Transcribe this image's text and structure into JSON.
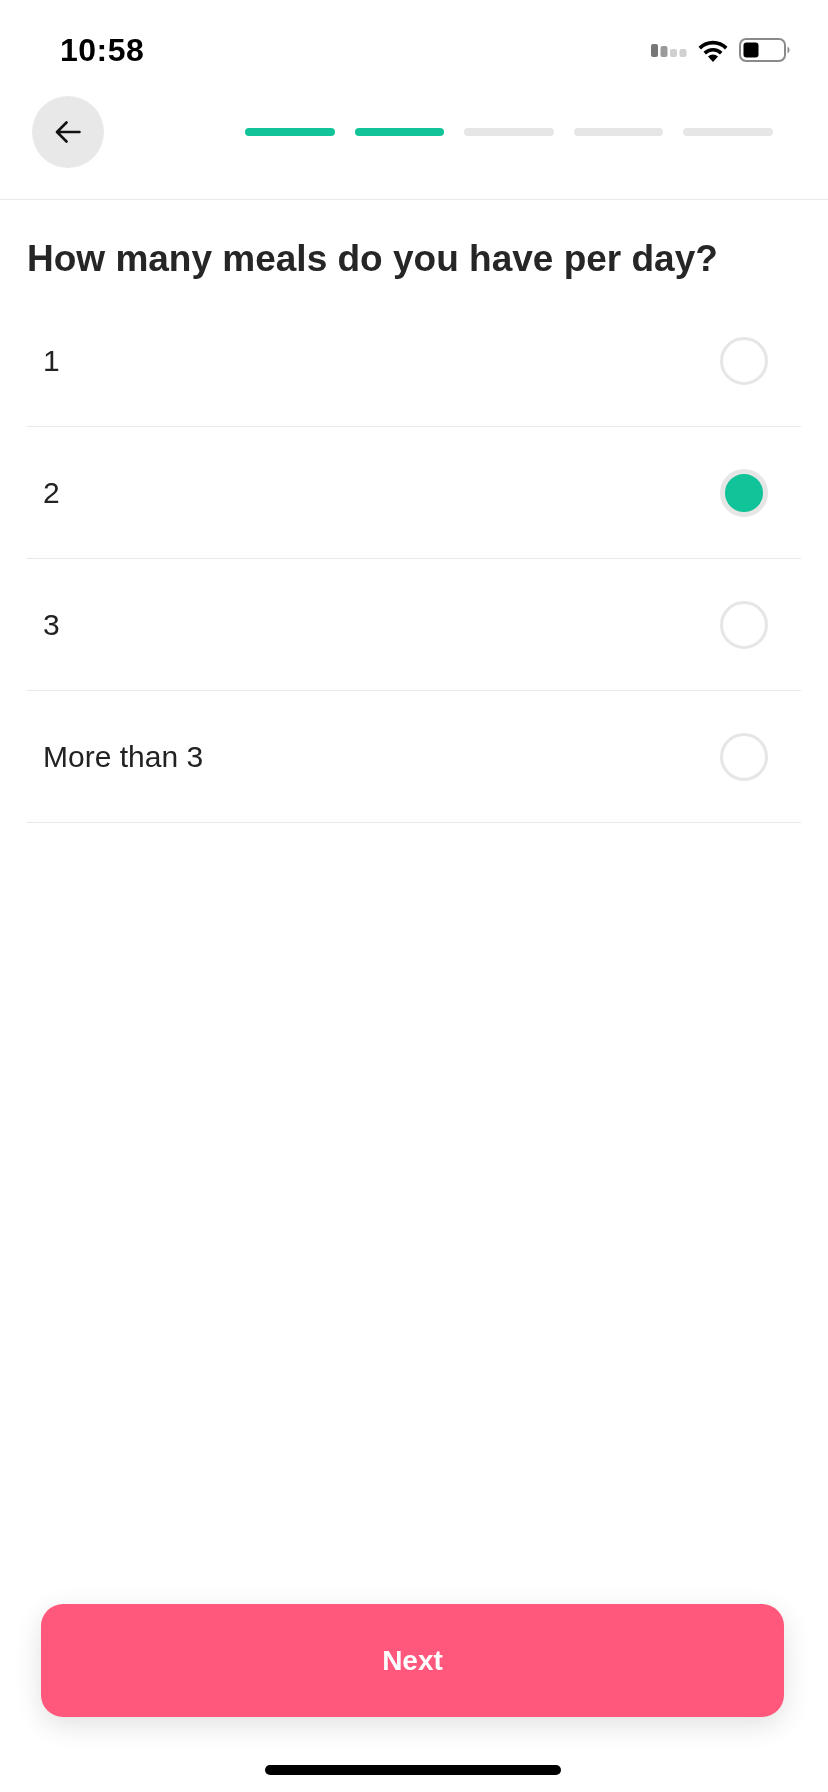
{
  "status_bar": {
    "time": "10:58"
  },
  "header": {
    "progress": [
      {
        "completed": true
      },
      {
        "completed": true
      },
      {
        "completed": false
      },
      {
        "completed": false
      },
      {
        "completed": false
      }
    ]
  },
  "question": {
    "title": "How many meals do you have per day?",
    "options": [
      {
        "label": "1",
        "selected": false
      },
      {
        "label": "2",
        "selected": true
      },
      {
        "label": "3",
        "selected": false
      },
      {
        "label": "More than 3",
        "selected": false
      }
    ]
  },
  "footer": {
    "button": "Next"
  }
}
